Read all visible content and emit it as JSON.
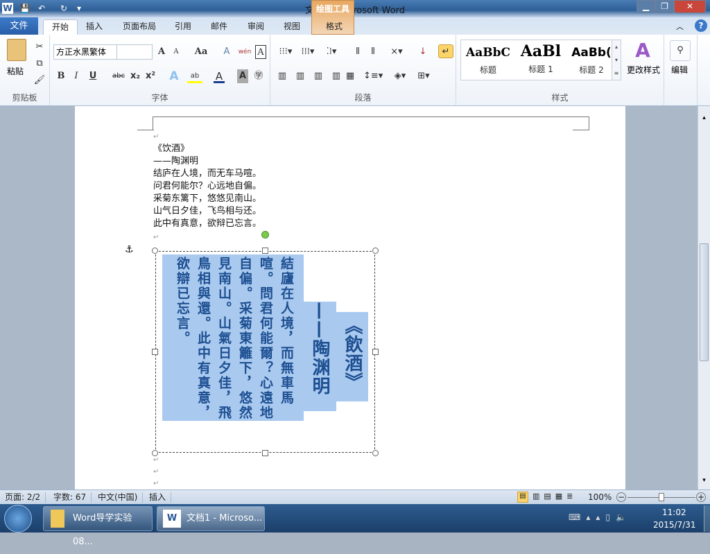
{
  "window": {
    "title": "文档1 - Microsoft Word",
    "context_tab_group": "绘图工具",
    "min": "▁",
    "max": "❐",
    "close": "✕"
  },
  "quick_access": {
    "word": "W",
    "save": "💾",
    "undo": "↶",
    "redo": "↻",
    "customize": "▾"
  },
  "tabs": [
    {
      "label": "文件"
    },
    {
      "label": "开始"
    },
    {
      "label": "插入"
    },
    {
      "label": "页面布局"
    },
    {
      "label": "引用"
    },
    {
      "label": "邮件"
    },
    {
      "label": "审阅"
    },
    {
      "label": "视图"
    },
    {
      "label": "格式"
    }
  ],
  "ribbon": {
    "clipboard": {
      "label": "剪贴板",
      "paste": "粘贴"
    },
    "font": {
      "label": "字体",
      "font_name": "方正水黑繁体",
      "font_size": "",
      "grow": "A",
      "shrink": "A",
      "case": "Aa",
      "clear": "A",
      "phonetic": "wén",
      "border": "A",
      "bold": "B",
      "italic": "I",
      "underline": "U",
      "strike": "abc",
      "sub": "x₂",
      "sup": "x²",
      "effects": "A",
      "highlight": "ab",
      "color": "A",
      "shading": "A",
      "enclose": "㊫"
    },
    "paragraph": {
      "label": "段落"
    },
    "styles": {
      "label": "样式",
      "items": [
        {
          "preview": "AaBbC",
          "name": "标题"
        },
        {
          "preview": "AaBl",
          "name": "标题 1"
        },
        {
          "preview": "AaBb(",
          "name": "标题 2"
        }
      ],
      "change": "更改样式"
    },
    "editing": {
      "label": "编辑"
    }
  },
  "document": {
    "lines": [
      "《饮酒》",
      "——陶渊明",
      "结庐在人境，而无车马喧。",
      "问君何能尔？心远地自偏。",
      "采菊东篱下，悠悠见南山。",
      "山气日夕佳，飞鸟相与还。",
      "此中有真意，欲辩已忘言。"
    ],
    "paragraph_mark": "↵",
    "textbox_columns": [
      "《飲酒》",
      "——陶渊明",
      "結廬在人境，而無車馬喧。",
      "問君何能爾？心遠地自偏。",
      "采菊東籬下，悠然見南山。",
      "山氣日夕佳，飛鳥相與還。",
      "此中有真意，欲辯已忘言。"
    ]
  },
  "status": {
    "page": "页面: 2/2",
    "words": "字数: 67",
    "lang": "中文(中国)",
    "mode": "插入",
    "zoom": "100%"
  },
  "taskbar": {
    "items": [
      "Word导学实验08...",
      "文档1 - Microso..."
    ],
    "time": "11:02",
    "date": "2015/7/31"
  }
}
